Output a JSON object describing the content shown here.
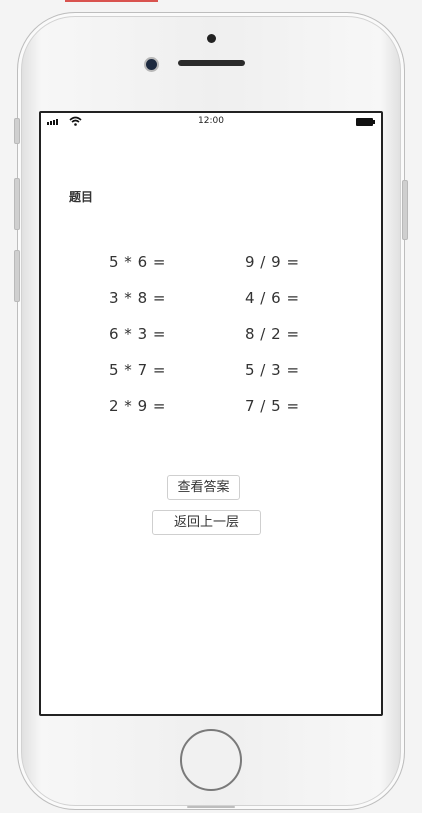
{
  "status_bar": {
    "time": "12:00"
  },
  "screen": {
    "title": "题目",
    "problems_left": [
      "5 * 6 =",
      "3 * 8 =",
      "6 * 3 =",
      "5 * 7 =",
      "2 * 9 ="
    ],
    "problems_right": [
      "9 / 9 =",
      "4 / 6 =",
      "8 / 2 =",
      "5 / 3 =",
      "7 / 5 ="
    ],
    "buttons": {
      "view_answer": "查看答案",
      "go_back": "返回上一层"
    }
  },
  "colors": {
    "accent": "#d9534f",
    "screen_border": "#222222",
    "text": "#333333"
  },
  "icons": [
    "signal-icon",
    "wifi-icon",
    "battery-icon",
    "home-button"
  ]
}
